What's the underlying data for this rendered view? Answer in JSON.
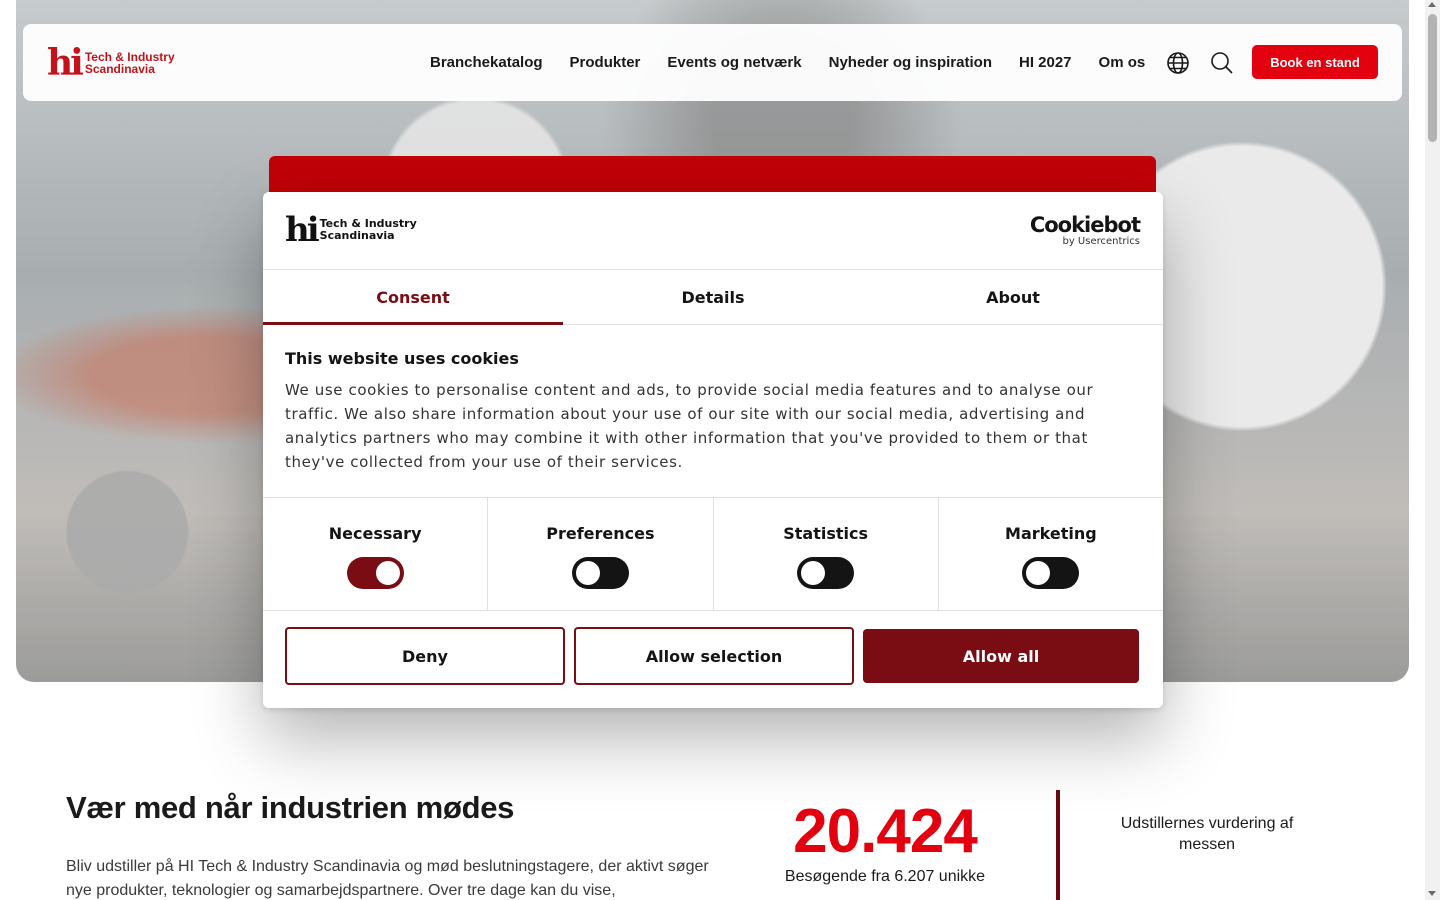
{
  "brand": {
    "mark": "hi",
    "line1": "Tech & Industry",
    "line2": "Scandinavia",
    "color": "#c4121b"
  },
  "nav": {
    "items": [
      "Branchekatalog",
      "Produkter",
      "Events og netværk",
      "Nyheder og inspiration",
      "HI 2027",
      "Om os"
    ],
    "globe_icon": "globe-icon",
    "search_icon": "search-icon",
    "cta_label": "Book en stand",
    "cta_color": "#e3000f"
  },
  "dialog": {
    "logo": {
      "mark": "hi",
      "line1": "Tech & Industry",
      "line2": "Scandinavia"
    },
    "provider": {
      "name": "Cookiebot",
      "sub": "by Usercentrics"
    },
    "tabs": [
      "Consent",
      "Details",
      "About"
    ],
    "active_tab": "Consent",
    "title": "This website uses cookies",
    "text": "We use cookies to personalise content and ads, to provide social media features and to analyse our traffic. We also share information about your use of our site with our social media, advertising and analytics partners who may combine it with other information that you've provided to them or that they've collected from your use of their services.",
    "categories": [
      {
        "label": "Necessary",
        "on": true
      },
      {
        "label": "Preferences",
        "on": false
      },
      {
        "label": "Statistics",
        "on": false
      },
      {
        "label": "Marketing",
        "on": false
      }
    ],
    "buttons": {
      "deny": "Deny",
      "allow_selection": "Allow selection",
      "allow_all": "Allow all"
    },
    "accent_color": "#7a0c13"
  },
  "content": {
    "title": "Vær med når industrien mødes",
    "text": "Bliv udstiller på HI Tech & Industry Scandinavia og mød beslutningstagere, der aktivt søger nye produkter, teknologier og samarbejdspartnere. Over tre dage kan du vise,",
    "stat_number": "20.424",
    "stat_label": "Besøgende fra 6.207 unikke",
    "rating_label": "Udstillernes vurdering af messen"
  }
}
